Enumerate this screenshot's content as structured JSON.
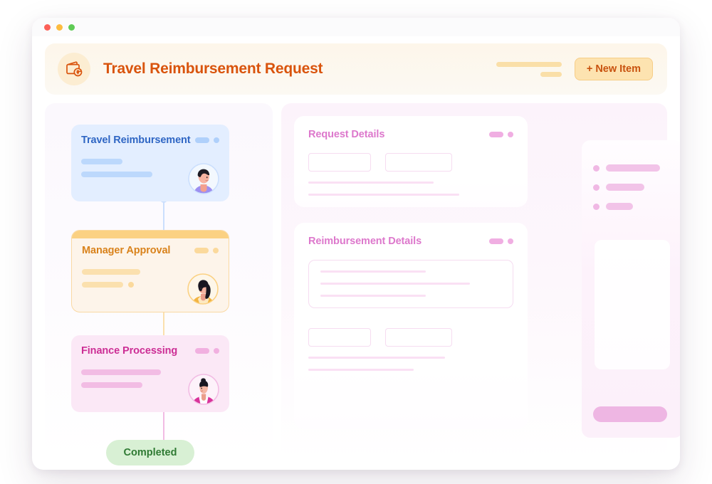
{
  "window": {
    "traffic_lights": [
      "red",
      "yellow",
      "green"
    ]
  },
  "header": {
    "icon": "wallet-dollar-refresh-icon",
    "title": "Travel Reimbursement Request",
    "new_item_label": "+ New Item",
    "accent_color": "#d9540d",
    "button_bg": "#fde3b0"
  },
  "workflow": {
    "steps": [
      {
        "title": "Travel Reimbursement",
        "accent": "#2f66c4",
        "avatar": "avatar-purple-top",
        "skeleton_lines": [
          58,
          100
        ],
        "has_trailing_dot": false
      },
      {
        "title": "Manager Approval",
        "accent": "#d9821b",
        "avatar": "avatar-yellow-top",
        "skeleton_lines": [
          82,
          58
        ],
        "has_trailing_dot": true
      },
      {
        "title": "Finance Processing",
        "accent": "#cc2e95",
        "avatar": "avatar-magenta-top",
        "skeleton_lines": [
          112,
          86
        ],
        "has_trailing_dot": false
      }
    ],
    "status": {
      "label": "Completed",
      "color": "#2f7a33",
      "bg": "#d8f0d4"
    }
  },
  "details": {
    "cards": [
      {
        "title": "Request Details",
        "fields": [
          "field-a",
          "field-b"
        ],
        "lines": [
          176,
          212
        ]
      },
      {
        "title": "Reimbursement Details",
        "textarea_lines": [
          148,
          210,
          148
        ],
        "fields": [
          "field-a",
          "field-b"
        ],
        "lines": [
          192,
          148
        ]
      }
    ],
    "accent_color": "#dd78cc"
  },
  "sidebar": {
    "items": [
      "list-item-1",
      "list-item-2",
      "list-item-3"
    ],
    "action_button": "primary-action-button"
  }
}
